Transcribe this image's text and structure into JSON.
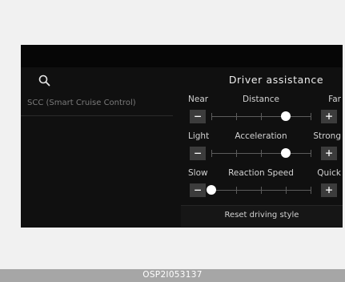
{
  "search": {
    "icon": "search-icon"
  },
  "panel": {
    "title": "Driver assistance"
  },
  "sidebar": {
    "items": [
      {
        "label": "SCC (Smart Cruise Control)"
      }
    ]
  },
  "settings": [
    {
      "name": "Distance",
      "left_label": "Near",
      "right_label": "Far",
      "position": 3,
      "steps": 4
    },
    {
      "name": "Acceleration",
      "left_label": "Light",
      "right_label": "Strong",
      "position": 3,
      "steps": 4
    },
    {
      "name": "Reaction Speed",
      "left_label": "Slow",
      "right_label": "Quick",
      "position": 0,
      "steps": 4
    }
  ],
  "buttons": {
    "minus": "−",
    "plus": "+"
  },
  "reset": {
    "label": "Reset driving style"
  },
  "caption": {
    "text": "OSP2I053137"
  }
}
